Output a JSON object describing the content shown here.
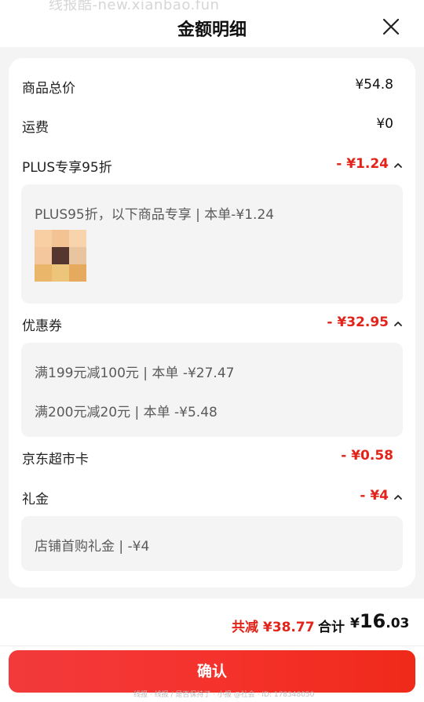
{
  "header": {
    "watermark": "线报酷-new.xianbao.fun",
    "title": "金额明细"
  },
  "rows": {
    "goods_total": {
      "label": "商品总价",
      "amount": "¥54.8"
    },
    "shipping": {
      "label": "运费",
      "amount": "¥0"
    },
    "plus": {
      "label": "PLUS专享95折",
      "amount": "- ¥1.24",
      "detail": "PLUS95折，以下商品专享 | 本单-¥1.24"
    },
    "coupon": {
      "label": "优惠券",
      "amount": "- ¥32.95",
      "details": [
        "满199元减100元 | 本单 -¥27.47",
        "满200元减20元 | 本单 -¥5.48"
      ]
    },
    "jd_card": {
      "label": "京东超市卡",
      "amount": "- ¥0.58"
    },
    "gift": {
      "label": "礼金",
      "amount": "- ¥4",
      "detail": "店铺首购礼金 | -¥4"
    }
  },
  "footer": {
    "saved_label": "共减 ¥38.77",
    "total_label": "合计",
    "total_currency": "¥",
    "total_int": "16",
    "total_dec": ".03",
    "confirm_label": "确认",
    "bottom_watermark": "线报 · 线报 / 是否保持了 · 小报 @社会 · ID: 178348050"
  },
  "colors": {
    "accent": "#e2231a",
    "button_start": "#f23a3c",
    "button_end": "#ef2a1a",
    "sheet_bg": "#f4f4f4"
  },
  "icons": {
    "close": "close-icon",
    "chevron": "chevron-up-icon"
  }
}
